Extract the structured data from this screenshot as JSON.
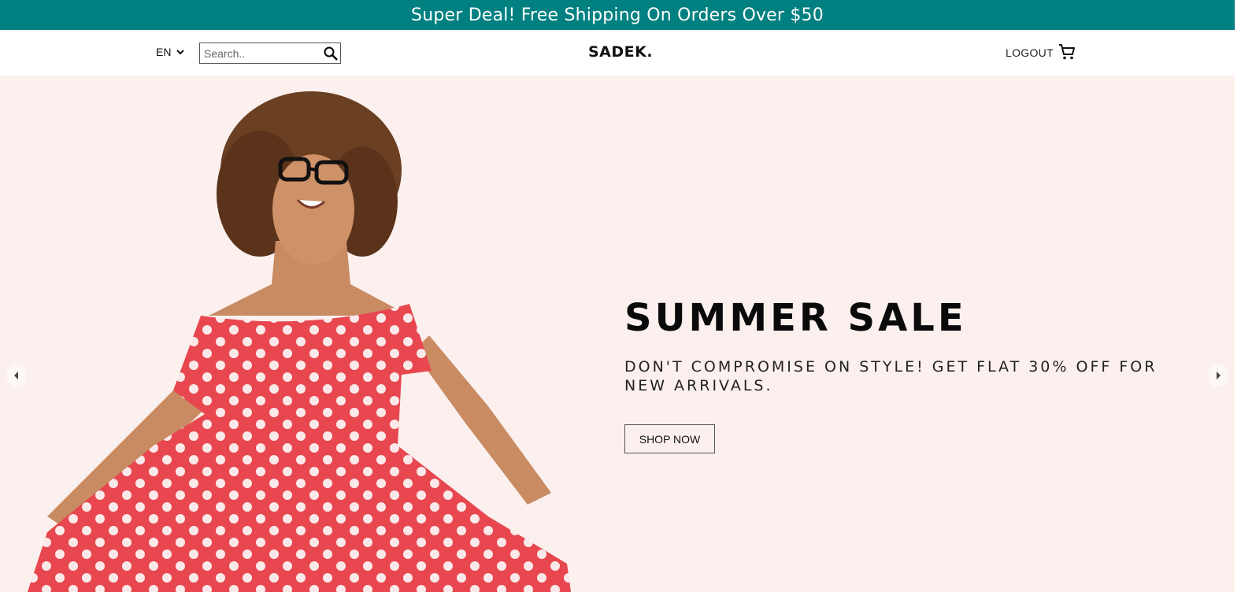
{
  "announcement": {
    "text": "Super Deal! Free Shipping On Orders Over $50",
    "bg_color": "#008080"
  },
  "navbar": {
    "language": {
      "selected": "EN",
      "icon": "chevron-down-icon"
    },
    "search": {
      "placeholder": "Search..",
      "value": "",
      "icon": "search-icon"
    },
    "logo": "SADEK.",
    "logout_label": "LOGOUT",
    "cart_icon": "shopping-cart-icon"
  },
  "hero": {
    "bg_color": "#fbf0ed",
    "title": "SUMMER SALE",
    "description": "DON'T COMPROMISE ON STYLE! GET FLAT 30% OFF FOR NEW ARRIVALS.",
    "cta_label": "SHOP NOW",
    "prev_icon": "arrow-left-icon",
    "next_icon": "arrow-right-icon",
    "image_subject": "woman in red polka dot dress"
  }
}
